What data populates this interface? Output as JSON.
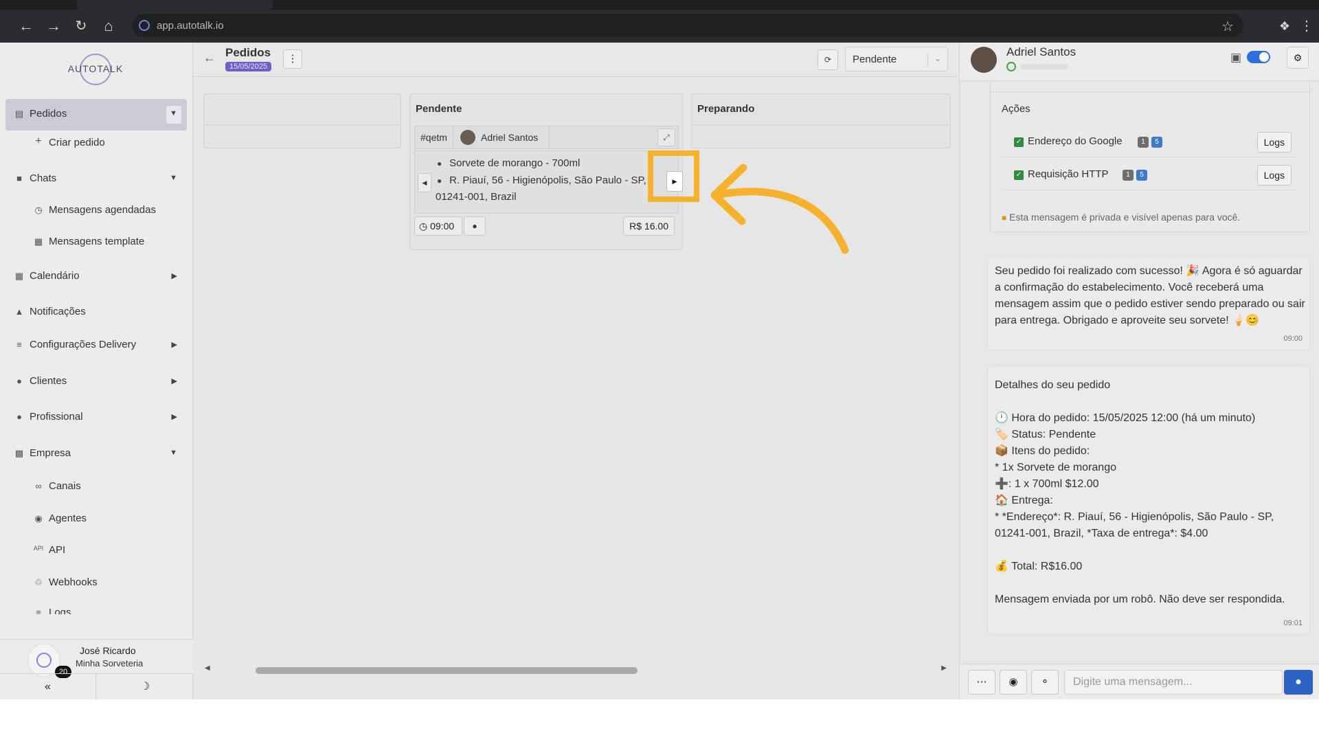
{
  "browser": {
    "url": "app.autotalk.io"
  },
  "sidebar": {
    "logo": "AUTOTALK",
    "items": [
      {
        "label": "Pedidos",
        "icon": "clipboard-icon"
      },
      {
        "label": "Criar pedido",
        "icon": "plus-icon"
      },
      {
        "label": "Chats",
        "icon": "chat-icon"
      },
      {
        "label": "Mensagens agendadas",
        "icon": "clock-icon"
      },
      {
        "label": "Mensagens template",
        "icon": "template-icon"
      },
      {
        "label": "Calendário",
        "icon": "calendar-icon"
      },
      {
        "label": "Notificações",
        "icon": "bell-icon"
      },
      {
        "label": "Configurações Delivery",
        "icon": "sliders-icon"
      },
      {
        "label": "Clientes",
        "icon": "users-icon"
      },
      {
        "label": "Profissional",
        "icon": "user-gear-icon"
      },
      {
        "label": "Empresa",
        "icon": "building-icon"
      },
      {
        "label": "Canais",
        "icon": "link-icon"
      },
      {
        "label": "Agentes",
        "icon": "robot-icon"
      },
      {
        "label": "API",
        "icon": "api-icon"
      },
      {
        "label": "Webhooks",
        "icon": "webhook-icon"
      },
      {
        "label": "Logs",
        "icon": "list-icon"
      }
    ],
    "user": {
      "name": "José Ricardo",
      "company": "Minha Sorveteria",
      "badge": "20"
    }
  },
  "board": {
    "title": "Pedidos",
    "date": "15/05/2025",
    "status_filter": "Pendente",
    "columns": [
      {
        "title": ""
      },
      {
        "title": "Pendente"
      },
      {
        "title": "Preparando"
      }
    ],
    "card": {
      "code": "#qetm",
      "client": "Adriel Santos",
      "item": "Sorvete de morango - 700ml",
      "address_line1": "R. Piauí, 56 - Higienópolis, São Paulo - SP,",
      "address_line2": "01241-001, Brazil",
      "time": "09:00",
      "price": "R$ 16.00"
    }
  },
  "chat": {
    "contact": "Adriel Santos",
    "actions_title": "Ações",
    "actions": [
      {
        "label": "Endereço do Google",
        "b1": "1",
        "b2": "5",
        "button": "Logs"
      },
      {
        "label": "Requisição HTTP",
        "b1": "1",
        "b2": "5",
        "button": "Logs"
      }
    ],
    "private_note": "Esta mensagem é privada e visível apenas para você.",
    "messages": [
      {
        "text": "Seu pedido foi realizado com sucesso! 🎉 Agora é só aguardar a confirmação do estabelecimento. Você receberá uma mensagem assim que o pedido estiver sendo preparado ou sair para entrega. Obrigado e aproveite seu sorvete! 🍦😊",
        "time": "09:00"
      },
      {
        "text": "Detalhes do seu pedido\n\n🕛 Hora do pedido: 15/05/2025 12:00 (há um minuto)\n🏷️ Status: Pendente\n📦 Itens do pedido:\n* 1x Sorvete de morango\n➕: 1 x 700ml $12.00\n🏠 Entrega:\n* *Endereço*: R. Piauí, 56 - Higienópolis, São Paulo - SP, 01241-001, Brazil, *Taxa de entrega*: $4.00\n\n💰 Total: R$16.00\n\nMensagem enviada por um robô. Não deve ser respondida.",
        "time": "09:01"
      }
    ],
    "input_placeholder": "Digite uma mensagem..."
  },
  "colors": {
    "accent": "#6c5fc7",
    "highlight": "#f6b22d",
    "toggle": "#2d6fdc",
    "send": "#2b62c4"
  }
}
